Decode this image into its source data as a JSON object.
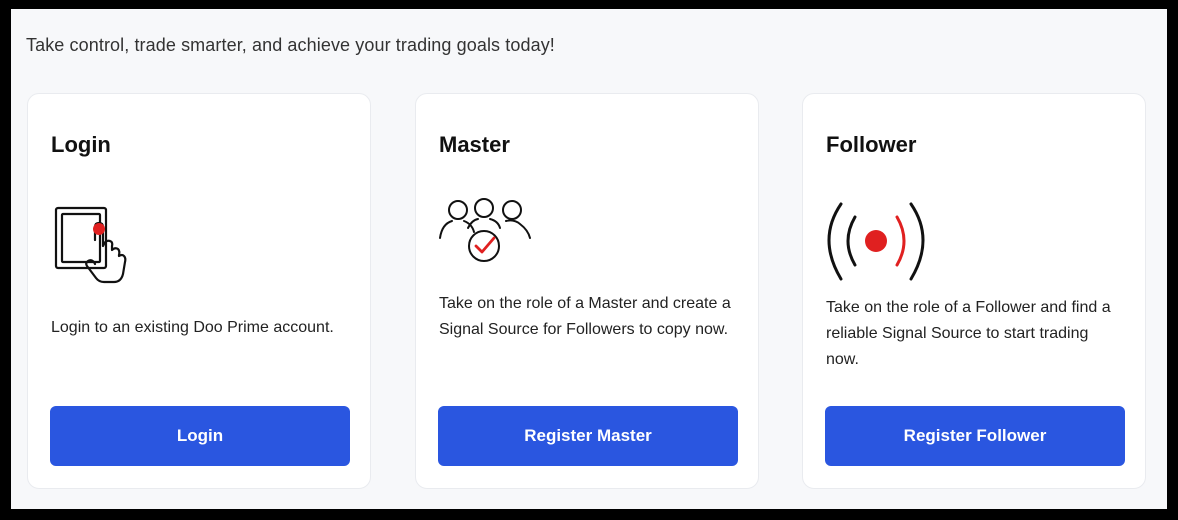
{
  "header": {
    "tagline": "Take control, trade smarter, and achieve your trading goals today!"
  },
  "cards": [
    {
      "title": "Login",
      "icon": "touch-screen-icon",
      "description": "Login to an existing Doo Prime account.",
      "button_label": "Login"
    },
    {
      "title": "Master",
      "icon": "group-check-icon",
      "description": "Take on the role of a Master and create a Signal Source for Followers to copy now.",
      "button_label": "Register Master"
    },
    {
      "title": "Follower",
      "icon": "broadcast-signal-icon",
      "description": "Take on the role of a Follower and find a reliable Signal Source to start trading now.",
      "button_label": "Register Follower"
    }
  ],
  "colors": {
    "primary_button": "#2a56e0",
    "accent_red": "#e02020",
    "page_background": "#f7f8fa",
    "frame": "#000000"
  }
}
